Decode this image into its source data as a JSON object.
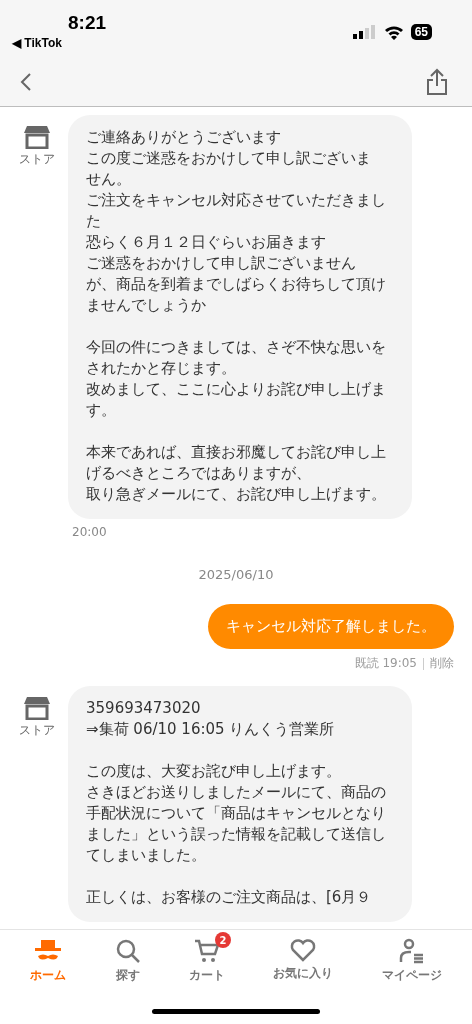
{
  "status_bar": {
    "time": "8:21",
    "back_app": "◀ TikTok",
    "battery": "65"
  },
  "messages": [
    {
      "kind": "store",
      "sender": "ストア",
      "paragraphs": [
        [
          "ご連絡ありがとうございます",
          "この度ご迷惑をおかけして申し訳ございま",
          "せん。",
          "ご注文をキャンセル対応させていただきまし",
          "た",
          "恐らく６月１２日ぐらいお届きます",
          "ご迷惑をおかけして申し訳ございません",
          "が、商品を到着までしばらくお待ちして頂け",
          "ませんでしょうか"
        ],
        [
          "今回の件につきましては、さぞ不快な思いを",
          "されたかと存じます。",
          "改めまして、ここに心よりお詫び申し上げま",
          "す。"
        ],
        [
          "本来であれば、直接お邪魔してお詫び申し上",
          "げるべきところではありますが、",
          "取り急ぎメールにて、お詫び申し上げます。"
        ]
      ],
      "time": "20:00"
    },
    {
      "kind": "date",
      "text": "2025/06/10"
    },
    {
      "kind": "user",
      "text": "キャンセル対応了解しました。",
      "read": "既読 19:05",
      "action": "削除"
    },
    {
      "kind": "store",
      "sender": "ストア",
      "paragraphs": [
        [
          "359693473020",
          "⇒集荷 06/10 16:05 りんくう営業所"
        ],
        [
          "この度は、大変お詫び申し上げます。",
          "さきほどお送りしましたメールにて、商品の",
          "手配状況について「商品はキャンセルとなり",
          "ました」という誤った情報を記載して送信し",
          "てしまいました。"
        ],
        [
          "正しくは、お客様のご注文商品は、[6月９"
        ]
      ]
    }
  ],
  "tab_bar": [
    {
      "kind": "home",
      "label": "ホーム",
      "selected": true
    },
    {
      "kind": "search",
      "label": "探す",
      "selected": false
    },
    {
      "kind": "cart",
      "label": "カート",
      "selected": false,
      "badge": "2"
    },
    {
      "kind": "heart",
      "label": "お気に入り",
      "selected": false
    },
    {
      "kind": "mypage",
      "label": "マイページ",
      "selected": false
    }
  ]
}
